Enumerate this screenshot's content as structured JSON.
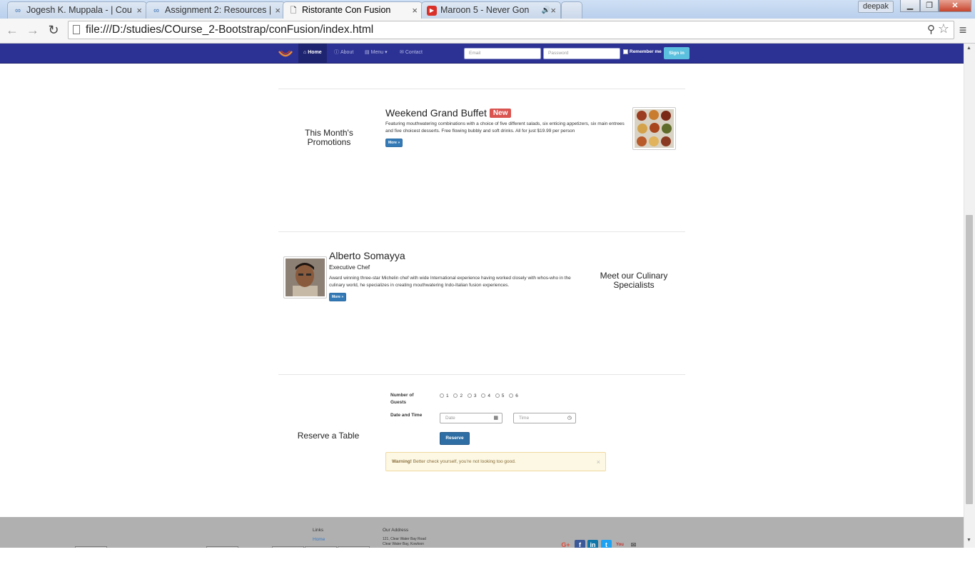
{
  "browser": {
    "tabs": [
      {
        "title": "Jogesh K. Muppala - | Cou",
        "icon": "coursera-icon"
      },
      {
        "title": "Assignment 2: Resources |",
        "icon": "coursera-icon"
      },
      {
        "title": "Ristorante Con Fusion",
        "icon": "page-icon"
      },
      {
        "title": "Maroon 5 - Never Gon",
        "icon": "youtube-icon"
      }
    ],
    "user": "deepak",
    "url": "file:///D:/studies/COurse_2-Bootstrap/conFusion/index.html"
  },
  "navbar": {
    "links": [
      "Home",
      "About",
      "Menu",
      "Contact"
    ],
    "email_placeholder": "Email",
    "password_placeholder": "Password",
    "remember_label": "Remember me",
    "signin_label": "Sign in",
    "brand_color": "#2c3294"
  },
  "promotions": {
    "section_title": "This Month's Promotions",
    "heading": "Weekend Grand Buffet",
    "badge": "New",
    "description": "Featuring mouthwatering combinations with a choice of five different salads, six enticing appetizers, six main entrees and five choicest desserts. Free flowing bubbly and soft drinks. All for just $19.99 per person",
    "more": "More »"
  },
  "specialists": {
    "section_title": "Meet our Culinary Specialists",
    "name": "Alberto Somayya",
    "role": "Executive Chef",
    "description": "Award winning three-star Michelin chef with wide International experience having worked closely with whos-who in the culinary world, he specializes in creating mouthwatering Indo-Italian fusion experiences.",
    "more": "More »"
  },
  "reservation": {
    "section_title": "Reserve a Table",
    "guests_label": "Number of Guests",
    "guest_options": [
      "1",
      "2",
      "3",
      "4",
      "5",
      "6"
    ],
    "datetime_label": "Date and Time",
    "date_placeholder": "Date",
    "time_placeholder": "Time",
    "reserve_label": "Reserve",
    "warning_strong": "Warning!",
    "warning_text": "Better check yourself, you're not looking too good.",
    "alert_close": "×"
  },
  "footer": {
    "links_heading": "Links",
    "links": [
      "Home"
    ],
    "address_heading": "Our Address",
    "address_lines": [
      "121, Clear Water Bay Road",
      "Clear Water Bay, Kowloon"
    ],
    "social": [
      "G+",
      "f",
      "in",
      "t",
      "You",
      "✉"
    ]
  }
}
